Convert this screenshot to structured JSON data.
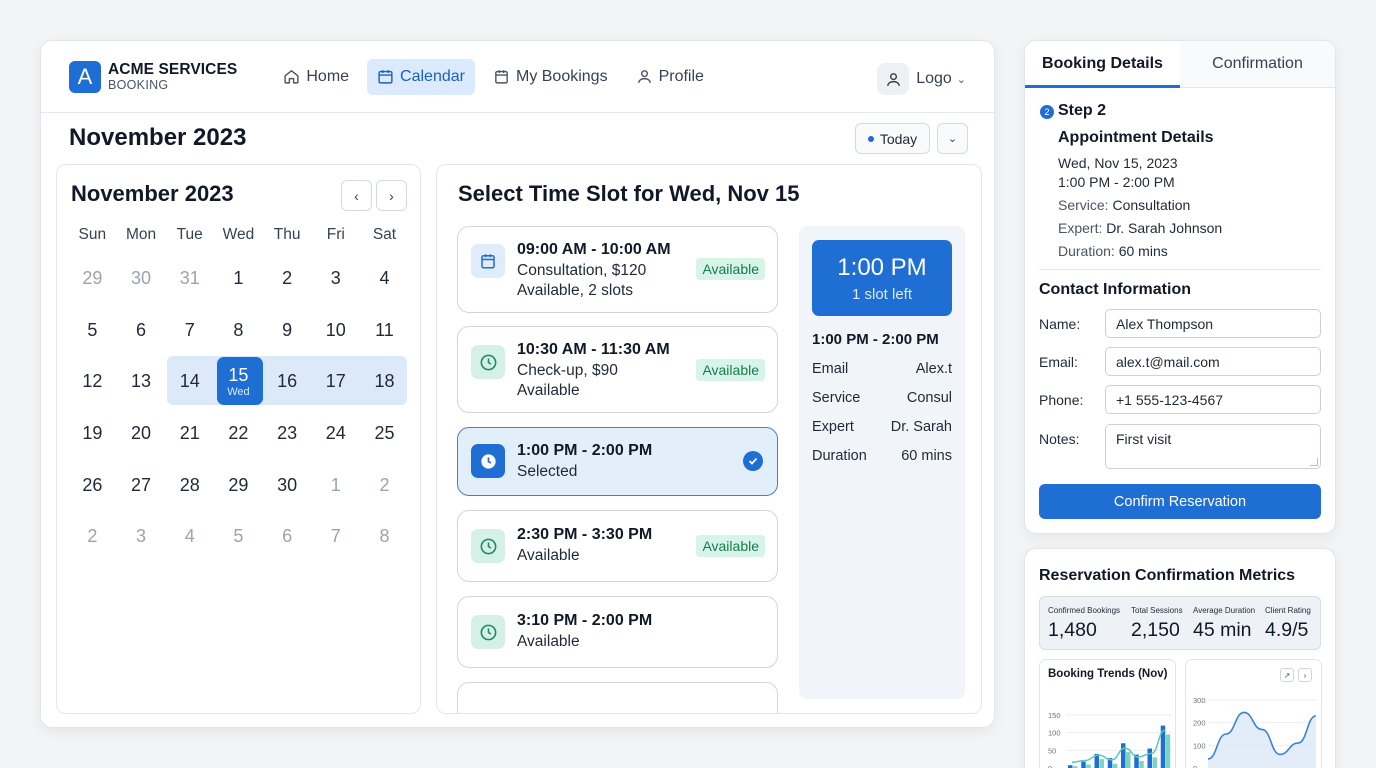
{
  "app": {
    "brand_title": "ACME SERVICES",
    "brand_subtitle": "BOOKING",
    "brand_mark": "A"
  },
  "nav": {
    "items": [
      {
        "label": "Home",
        "icon": "home-icon"
      },
      {
        "label": "Calendar",
        "icon": "calendar-icon",
        "active": true
      },
      {
        "label": "My Bookings",
        "icon": "bookings-icon"
      },
      {
        "label": "Profile",
        "icon": "profile-icon"
      }
    ],
    "user_label": "Logo"
  },
  "header": {
    "month_title": "November 2023",
    "today_label": "Today"
  },
  "calendar": {
    "title": "November 2023",
    "weekdays": [
      "Sun",
      "Mon",
      "Tue",
      "Wed",
      "Thu",
      "Fri",
      "Sat"
    ],
    "days": [
      {
        "n": "29",
        "muted": true
      },
      {
        "n": "30",
        "muted": true
      },
      {
        "n": "31",
        "muted": true
      },
      {
        "n": "1"
      },
      {
        "n": "2"
      },
      {
        "n": "3"
      },
      {
        "n": "4"
      },
      {
        "n": "5"
      },
      {
        "n": "6"
      },
      {
        "n": "7"
      },
      {
        "n": "8"
      },
      {
        "n": "9"
      },
      {
        "n": "10"
      },
      {
        "n": "11"
      },
      {
        "n": "12"
      },
      {
        "n": "13"
      },
      {
        "n": "14"
      },
      {
        "n": "15",
        "selected": true,
        "sub": "Wed"
      },
      {
        "n": "16"
      },
      {
        "n": "17"
      },
      {
        "n": "18"
      },
      {
        "n": "19"
      },
      {
        "n": "20"
      },
      {
        "n": "21"
      },
      {
        "n": "22"
      },
      {
        "n": "23"
      },
      {
        "n": "24"
      },
      {
        "n": "25"
      },
      {
        "n": "26"
      },
      {
        "n": "27"
      },
      {
        "n": "28"
      },
      {
        "n": "29"
      },
      {
        "n": "30"
      },
      {
        "n": "1",
        "muted": true
      },
      {
        "n": "2",
        "muted": true
      },
      {
        "n": "2",
        "muted": true
      },
      {
        "n": "3",
        "muted": true
      },
      {
        "n": "4",
        "muted": true
      },
      {
        "n": "5",
        "muted": true
      },
      {
        "n": "6",
        "muted": true
      },
      {
        "n": "7",
        "muted": true
      },
      {
        "n": "8",
        "muted": true
      }
    ]
  },
  "slots": {
    "title": "Select Time Slot for Wed, Nov 15",
    "items": [
      {
        "time": "09:00 AM - 10:00 AM",
        "line1": "Consultation, $120",
        "line2": "Available, 2 slots",
        "badge": "Available",
        "icon": "calendar-icon"
      },
      {
        "time": "10:30 AM - 11:30 AM",
        "line1": "Check-up, $90",
        "line2": "Available",
        "badge": "Available",
        "icon": "clock-icon"
      },
      {
        "time": "1:00 PM - 2:00 PM",
        "line1": "Selected",
        "selected": true,
        "icon": "clock-icon"
      },
      {
        "time": "2:30 PM - 3:30 PM",
        "line1": "Available",
        "badge": "Available",
        "icon": "clock-icon"
      },
      {
        "time": "3:10 PM - 2:00 PM",
        "line1": "Available",
        "icon": "clock-icon"
      }
    ]
  },
  "summary": {
    "time": "1:00 PM",
    "slots_left": "1 slot left",
    "range": "1:00 PM - 2:00 PM",
    "rows": [
      {
        "k": "Email",
        "v": "Alex.t"
      },
      {
        "k": "Service",
        "v": "Consul"
      },
      {
        "k": "Expert",
        "v": "Dr. Sarah"
      },
      {
        "k": "Duration",
        "v": "60 mins"
      }
    ]
  },
  "booking": {
    "tabs": [
      "Booking Details",
      "Confirmation"
    ],
    "step_num": "2",
    "step": "Step 2",
    "appt_title": "Appointment Details",
    "date": "Wed, Nov 15, 2023",
    "time": "1:00 PM - 2:00 PM",
    "service_label": "Service:",
    "service": "Consultation",
    "expert_label": "Expert:",
    "expert": "Dr. Sarah Johnson",
    "duration_label": "Duration:",
    "duration": "60 mins",
    "contact_title": "Contact Information",
    "fields": [
      {
        "label": "Name:",
        "value": "Alex Thompson"
      },
      {
        "label": "Email:",
        "value": "alex.t@mail.com"
      },
      {
        "label": "Phone:",
        "value": "+1 555-123-4567"
      },
      {
        "label": "Notes:",
        "value": "First visit"
      }
    ],
    "confirm_label": "Confirm Reservation"
  },
  "metrics": {
    "title": "Reservation Confirmation Metrics",
    "stats": [
      {
        "label": "Confirmed Bookings",
        "value": "1,480"
      },
      {
        "label": "Total Sessions",
        "value": "2,150"
      },
      {
        "label": "Average Duration",
        "value": "45 min"
      },
      {
        "label": "Client Rating",
        "value": "4.9/5"
      }
    ],
    "chart1_title": "Booking Trends (Nov)",
    "chart1_ticks": [
      "150",
      "100",
      "50",
      "0"
    ],
    "chart2_ticks": [
      "300",
      "200",
      "100",
      "0"
    ]
  },
  "chart_data": [
    {
      "type": "bar",
      "title": "Booking Trends (Nov)",
      "ylim": [
        0,
        150
      ],
      "yticks": [
        0,
        50,
        100,
        150
      ],
      "series": [
        {
          "name": "",
          "values": [
            8,
            18,
            40,
            28,
            70,
            38,
            55,
            120
          ]
        },
        {
          "name": "",
          "values": [
            5,
            10,
            25,
            12,
            45,
            20,
            30,
            95
          ]
        }
      ],
      "colors": [
        "#1f6ed4",
        "#7dd3c0"
      ]
    },
    {
      "type": "area",
      "ylim": [
        0,
        300
      ],
      "yticks": [
        0,
        100,
        200,
        300
      ],
      "values": [
        40,
        150,
        245,
        170,
        60,
        110,
        230
      ],
      "colors": [
        "#3b82d6"
      ]
    }
  ]
}
